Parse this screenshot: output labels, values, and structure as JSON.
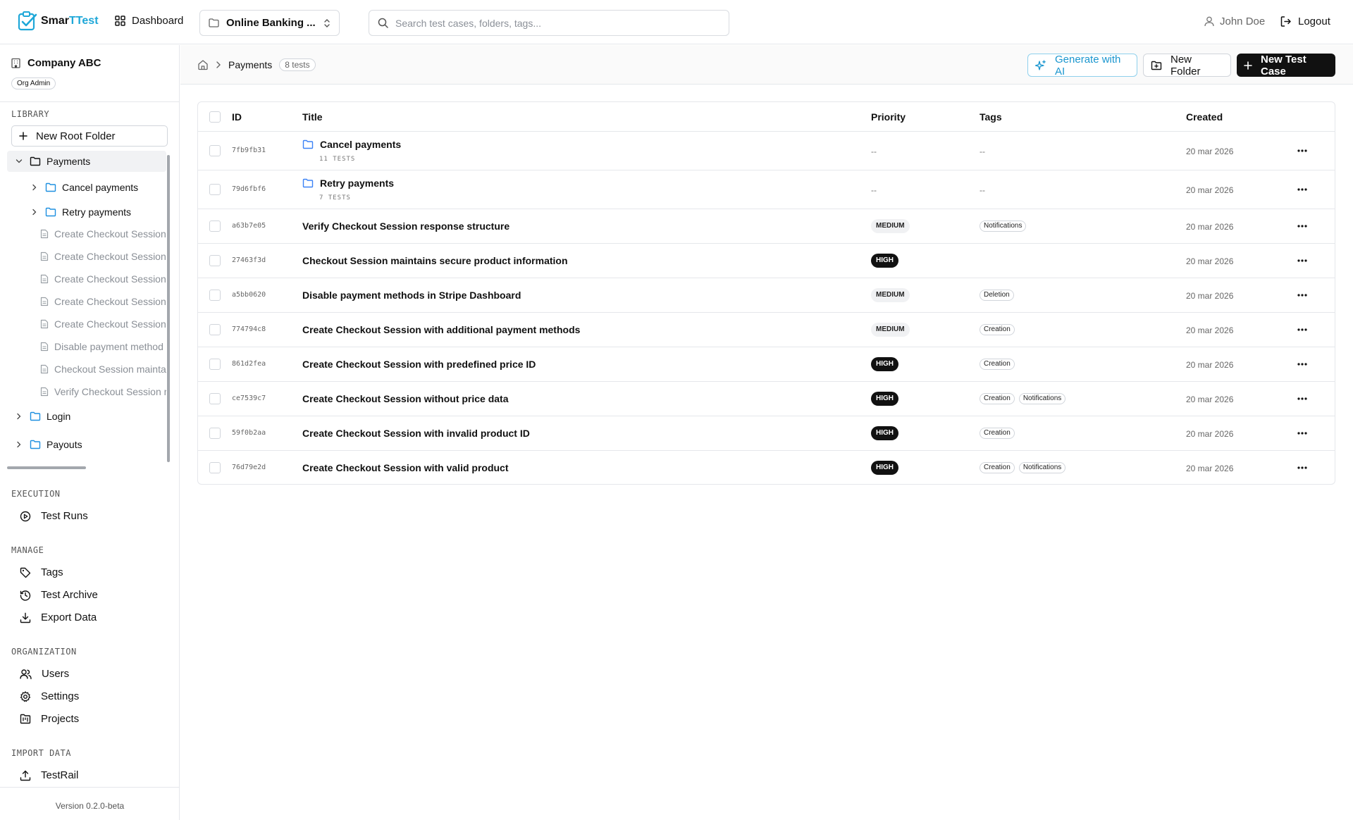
{
  "app": {
    "logo_prefix": "Smar",
    "logo_suffix": "TTest",
    "dashboard": "Dashboard",
    "project": "Online Banking ...",
    "search_placeholder": "Search test cases, folders, tags...",
    "user": "John Doe",
    "logout": "Logout"
  },
  "sidebar": {
    "org_name": "Company ABC",
    "org_role": "Org Admin",
    "library_label": "LIBRARY",
    "new_root_folder": "New Root Folder",
    "tree": [
      {
        "label": "Payments",
        "kind": "folder",
        "level": 0,
        "expanded": true,
        "selected": true
      },
      {
        "label": "Cancel payments",
        "kind": "folder",
        "level": 1,
        "expanded": false
      },
      {
        "label": "Retry payments",
        "kind": "folder",
        "level": 1,
        "expanded": false
      },
      {
        "label": "Create Checkout Session",
        "kind": "file",
        "level": 1
      },
      {
        "label": "Create Checkout Session",
        "kind": "file",
        "level": 1
      },
      {
        "label": "Create Checkout Session",
        "kind": "file",
        "level": 1
      },
      {
        "label": "Create Checkout Session",
        "kind": "file",
        "level": 1
      },
      {
        "label": "Create Checkout Session",
        "kind": "file",
        "level": 1
      },
      {
        "label": "Disable payment method",
        "kind": "file",
        "level": 1
      },
      {
        "label": "Checkout Session mainta",
        "kind": "file",
        "level": 1
      },
      {
        "label": "Verify Checkout Session r",
        "kind": "file",
        "level": 1
      },
      {
        "label": "Login",
        "kind": "folder",
        "level": 0,
        "expanded": false
      },
      {
        "label": "Payouts",
        "kind": "folder",
        "level": 0,
        "expanded": false
      }
    ],
    "execution_label": "EXECUTION",
    "test_runs": "Test Runs",
    "manage_label": "MANAGE",
    "tags": "Tags",
    "test_archive": "Test Archive",
    "export_data": "Export Data",
    "organization_label": "ORGANIZATION",
    "users": "Users",
    "settings": "Settings",
    "projects": "Projects",
    "import_label": "IMPORT DATA",
    "testrail": "TestRail",
    "version": "Version 0.2.0-beta"
  },
  "main": {
    "breadcrumb": "Payments",
    "test_count": "8 tests",
    "generate_ai": "Generate with AI",
    "new_folder": "New Folder",
    "new_test_case": "New Test Case"
  },
  "table": {
    "headers": {
      "id": "ID",
      "title": "Title",
      "priority": "Priority",
      "tags": "Tags",
      "created": "Created"
    },
    "folders": [
      {
        "id": "7fb9fb31",
        "title": "Cancel payments",
        "sub": "11 TESTS",
        "priority": "--",
        "tags": "--",
        "created": "20 mar 2026"
      },
      {
        "id": "79d6fbf6",
        "title": "Retry payments",
        "sub": "7 TESTS",
        "priority": "--",
        "tags": "--",
        "created": "20 mar 2026"
      }
    ],
    "rows": [
      {
        "id": "a63b7e05",
        "title": "Verify Checkout Session response structure",
        "priority": "MEDIUM",
        "tags": [
          "Notifications"
        ],
        "created": "20 mar 2026"
      },
      {
        "id": "27463f3d",
        "title": "Checkout Session maintains secure product information",
        "priority": "HIGH",
        "tags": [],
        "created": "20 mar 2026"
      },
      {
        "id": "a5bb0620",
        "title": "Disable payment methods in Stripe Dashboard",
        "priority": "MEDIUM",
        "tags": [
          "Deletion"
        ],
        "created": "20 mar 2026"
      },
      {
        "id": "774794c8",
        "title": "Create Checkout Session with additional payment methods",
        "priority": "MEDIUM",
        "tags": [
          "Creation"
        ],
        "created": "20 mar 2026"
      },
      {
        "id": "861d2fea",
        "title": "Create Checkout Session with predefined price ID",
        "priority": "HIGH",
        "tags": [
          "Creation"
        ],
        "created": "20 mar 2026"
      },
      {
        "id": "ce7539c7",
        "title": "Create Checkout Session without price data",
        "priority": "HIGH",
        "tags": [
          "Creation",
          "Notifications"
        ],
        "created": "20 mar 2026"
      },
      {
        "id": "59f0b2aa",
        "title": "Create Checkout Session with invalid product ID",
        "priority": "HIGH",
        "tags": [
          "Creation"
        ],
        "created": "20 mar 2026"
      },
      {
        "id": "76d79e2d",
        "title": "Create Checkout Session with valid product",
        "priority": "HIGH",
        "tags": [
          "Creation",
          "Notifications"
        ],
        "created": "20 mar 2026"
      }
    ]
  },
  "colors": {
    "accent": "#1ea7d8",
    "ai": "#1a96cf",
    "primary_button": "#111111",
    "folder": "#3b82f6"
  }
}
